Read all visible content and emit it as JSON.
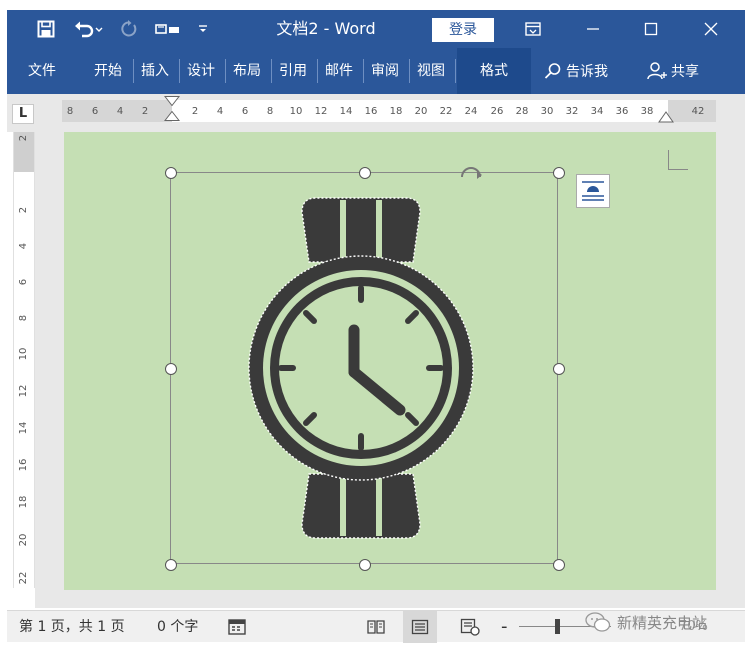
{
  "colors": {
    "accent": "#2b579a",
    "page_bg": "#c5dfb4",
    "watch": "#3a3a3a"
  },
  "title_bar": {
    "doc_title": "文档2  -  Word",
    "login_label": "登录",
    "quick_access": [
      "save-icon",
      "undo-icon",
      "redo-icon",
      "touch-mode-icon",
      "customize-icon"
    ],
    "window_controls": [
      "ribbon-display-icon",
      "minimize-icon",
      "maximize-icon",
      "close-icon"
    ]
  },
  "ribbon": {
    "tabs": [
      {
        "id": "file",
        "label": "文件"
      },
      {
        "id": "home",
        "label": "开始"
      },
      {
        "id": "insert",
        "label": "插入"
      },
      {
        "id": "design",
        "label": "设计"
      },
      {
        "id": "layout",
        "label": "布局"
      },
      {
        "id": "references",
        "label": "引用"
      },
      {
        "id": "mailings",
        "label": "邮件"
      },
      {
        "id": "review",
        "label": "审阅"
      },
      {
        "id": "view",
        "label": "视图"
      },
      {
        "id": "format",
        "label": "格式"
      }
    ],
    "active_tab": "format",
    "tell_me_label": "告诉我",
    "share_label": "共享"
  },
  "ruler": {
    "tab_selector": "L",
    "horizontal_left": [
      "8",
      "6",
      "4",
      "2"
    ],
    "horizontal_right": [
      "2",
      "4",
      "6",
      "8",
      "10",
      "12",
      "14",
      "16",
      "18",
      "20",
      "22",
      "24",
      "26",
      "28",
      "30",
      "32",
      "34",
      "36",
      "38"
    ],
    "horizontal_end": "42",
    "vertical": [
      "2",
      "2",
      "4",
      "6",
      "8",
      "10",
      "12",
      "14",
      "16",
      "18",
      "20",
      "22"
    ]
  },
  "status_bar": {
    "pages": "第 1 页，共 1 页",
    "words": "0 个字",
    "zoom_level": "70%"
  },
  "watermark": {
    "text": "新精英充电站"
  }
}
